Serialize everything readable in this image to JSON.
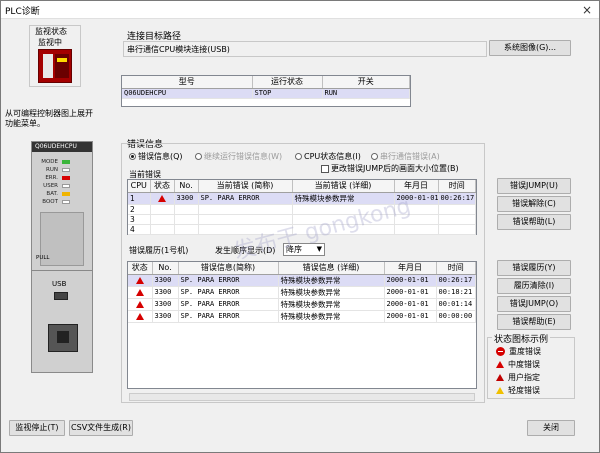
{
  "window": {
    "title": "PLC诊断",
    "close_glyph": "×"
  },
  "monitor": {
    "status_label": "监视状态",
    "status_value": "监视中"
  },
  "left_note": "从可编程控制器图上展开功能菜单。",
  "plc_image": {
    "model_text": "Q06UDEHCPU",
    "leds": [
      "MODE",
      "RUN",
      "ERR.",
      "USER",
      "BAT.",
      "BOOT"
    ],
    "led_colors": [
      "#3ab53a",
      "#ffffff",
      "#d60000",
      "#ffffff",
      "#f0b400",
      "#ffffff"
    ],
    "pull_label": "PULL",
    "usb_label": "USB"
  },
  "connection": {
    "group_label": "连接目标路径",
    "path_value": "串行通信CPU模块连接(USB)",
    "system_image_button": "系统图像(G)..."
  },
  "cpu_table": {
    "headers": [
      "型号",
      "运行状态",
      "开关"
    ],
    "rows": [
      [
        "Q06UDEHCPU",
        "STOP",
        "RUN"
      ]
    ]
  },
  "error_info": {
    "group_label": "错误信息",
    "radios": [
      {
        "label": "错误信息(Q)",
        "selected": true,
        "enabled": true
      },
      {
        "label": "继续运行错误信息(W)",
        "selected": false,
        "enabled": false
      },
      {
        "label": "CPU状态信息(I)",
        "selected": false,
        "enabled": true
      },
      {
        "label": "串行通信错误(A)",
        "selected": false,
        "enabled": false
      }
    ],
    "checkbox_label": "更改错误JUMP后的画面大小位置(B)",
    "current_errors_label": "当前错误",
    "current_headers": [
      "CPU",
      "状态",
      "No.",
      "当前错误 (简称)",
      "当前错误 (详细)",
      "年月日",
      "时间"
    ],
    "current_rows": [
      {
        "cpu": "1",
        "status_icon": "warning-icon",
        "no": "3300",
        "short": "SP. PARA ERROR",
        "detail": "特殊模块参数异常",
        "date": "2000-01-01",
        "time": "00:26:17"
      },
      {
        "cpu": "2",
        "status_icon": "",
        "no": "",
        "short": "",
        "detail": "",
        "date": "",
        "time": ""
      },
      {
        "cpu": "3",
        "status_icon": "",
        "no": "",
        "short": "",
        "detail": "",
        "date": "",
        "time": ""
      },
      {
        "cpu": "4",
        "status_icon": "",
        "no": "",
        "short": "",
        "detail": "",
        "date": "",
        "time": ""
      }
    ],
    "buttons_current": [
      "错误JUMP(U)",
      "错误解除(C)",
      "错误帮助(L)"
    ]
  },
  "history": {
    "label": "错误履历(1号机)",
    "sort_label": "发生顺序显示(D)",
    "sort_value": "降序",
    "headers": [
      "状态",
      "No.",
      "错误信息(简称)",
      "错误信息 (详细)",
      "年月日",
      "时间"
    ],
    "rows": [
      {
        "no": "3300",
        "short": "SP. PARA ERROR",
        "detail": "特殊模块参数异常",
        "date": "2000-01-01",
        "time": "00:26:17"
      },
      {
        "no": "3300",
        "short": "SP. PARA ERROR",
        "detail": "特殊模块参数异常",
        "date": "2000-01-01",
        "time": "00:18:21"
      },
      {
        "no": "3300",
        "short": "SP. PARA ERROR",
        "detail": "特殊模块参数异常",
        "date": "2000-01-01",
        "time": "00:01:14"
      },
      {
        "no": "3300",
        "short": "SP. PARA ERROR",
        "detail": "特殊模块参数异常",
        "date": "2000-01-01",
        "time": "00:00:00"
      }
    ],
    "buttons": [
      "错误履历(Y)",
      "履历清除(I)",
      "错误JUMP(O)",
      "错误帮助(E)"
    ]
  },
  "legend": {
    "title": "状态图标示例",
    "items": [
      "重度错误",
      "中度错误",
      "用户指定",
      "轻度错误"
    ],
    "colors": [
      "#d60000",
      "#d60000",
      "#c00000",
      "#f0c000"
    ]
  },
  "footer": {
    "stop_monitor": "监视停止(T)",
    "csv_button": "CSV文件生成(R)",
    "close_button": "关闭"
  },
  "watermark": "发布于 gongkong"
}
